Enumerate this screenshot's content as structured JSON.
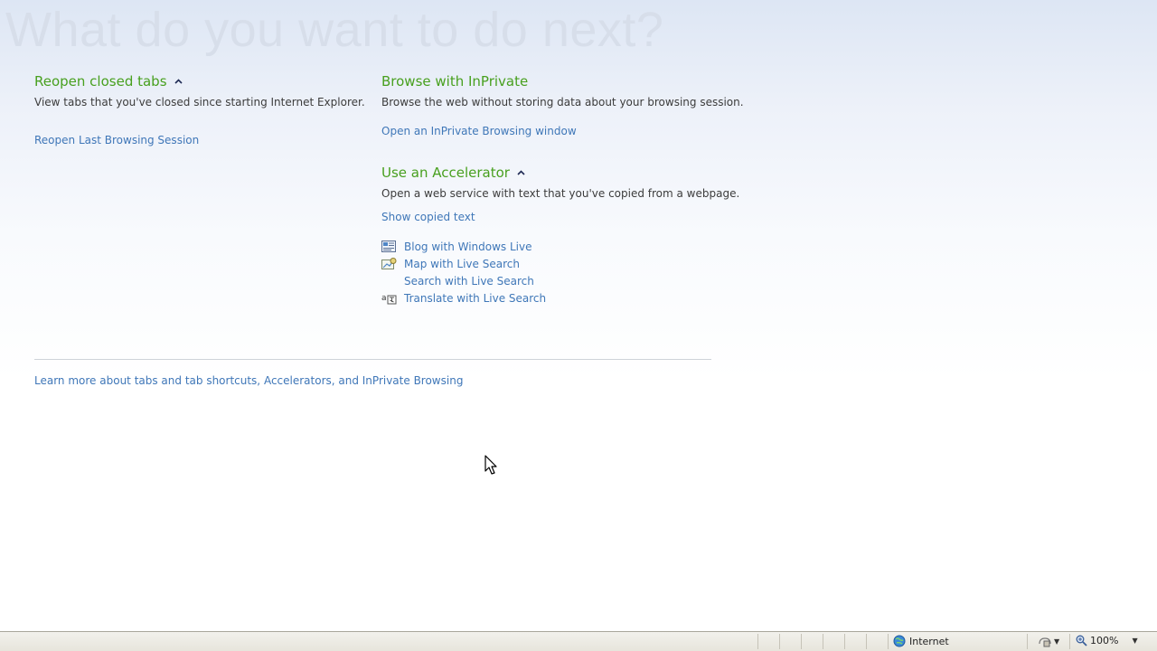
{
  "hero": {
    "title": "What do you want to do next?"
  },
  "reopen": {
    "title": "Reopen closed tabs",
    "description": "View tabs that you've closed since starting Internet Explorer.",
    "link": "Reopen Last Browsing Session"
  },
  "inprivate": {
    "title": "Browse with InPrivate",
    "description": "Browse the web without storing data about your browsing session.",
    "link": "Open an InPrivate Browsing window"
  },
  "accelerator": {
    "title": "Use an Accelerator",
    "description": "Open a web service with text that you've copied from a webpage.",
    "show_link": "Show copied text",
    "items": [
      {
        "label": "Blog with Windows Live",
        "icon": "blog-icon"
      },
      {
        "label": "Map with Live Search",
        "icon": "map-icon"
      },
      {
        "label": "Search with Live Search",
        "icon": ""
      },
      {
        "label": "Translate with Live Search",
        "icon": "translate-icon"
      }
    ]
  },
  "footer": {
    "learn_more": "Learn more about tabs and tab shortcuts, Accelerators, and InPrivate Browsing"
  },
  "statusbar": {
    "zone": "Internet",
    "zoom": "100%"
  },
  "colors": {
    "section_title": "#48a01f",
    "link": "#3f77b8",
    "hero": "#d7deea"
  }
}
